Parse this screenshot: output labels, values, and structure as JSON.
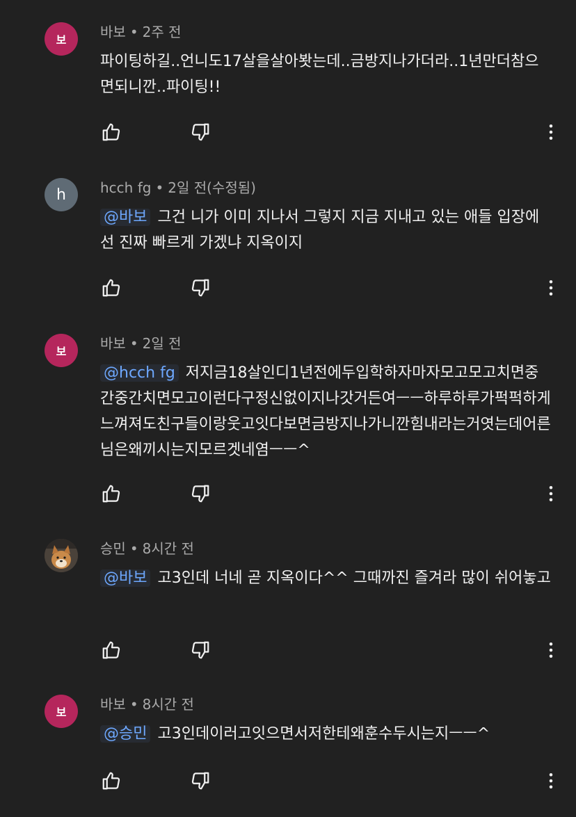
{
  "comments": [
    {
      "avatar_text": "보",
      "author": "바보",
      "separator": "•",
      "time": "2주 전",
      "mention": "",
      "text": "파이팅하길..언니도17살을살아봣는데..금방지나가더라..1년만더참으면되니깐..파이팅!!"
    },
    {
      "avatar_text": "h",
      "author": "hcch fg",
      "separator": "•",
      "time": "2일 전(수정됨)",
      "mention": "@바보",
      "text": "그건 니가 이미 지나서 그렇지 지금 지내고 있는 애들 입장에선 진짜 빠르게 가겠냐 지옥이지"
    },
    {
      "avatar_text": "보",
      "author": "바보",
      "separator": "•",
      "time": "2일 전",
      "mention": "@hcch fg",
      "text": "저지금18살인디1년전에두입학하자마자모고모고치면중간중간치면모고이런다구정신없이지나갓거든여ㅡㅡ하루하루가퍽퍽하게느껴져도친구들이랑웃고잇다보면금방지나가니깐힘내라는거엿는데어른님은왜끼시는지모르겟네염ㅡㅡ^"
    },
    {
      "avatar_text": "",
      "author": "승민",
      "separator": "•",
      "time": "8시간 전",
      "mention": "@바보",
      "text": "고3인데 너네 곧 지옥이다^^ 그때까진 즐겨라 많이 쉬어놓고"
    },
    {
      "avatar_text": "보",
      "author": "바보",
      "separator": "•",
      "time": "8시간 전",
      "mention": "@승민",
      "text": "고3인데이러고잇으면서저한테왜훈수두시는지ㅡㅡ^"
    }
  ],
  "icons": {
    "like": "thumbs-up-icon",
    "dislike": "thumbs-down-icon",
    "more": "more-vert-icon"
  },
  "colors": {
    "background": "#212121",
    "avatar_pink": "#b5265c",
    "avatar_gray": "#5f6b75",
    "mention": "#6ea8fe",
    "meta": "#aaaaaa"
  }
}
